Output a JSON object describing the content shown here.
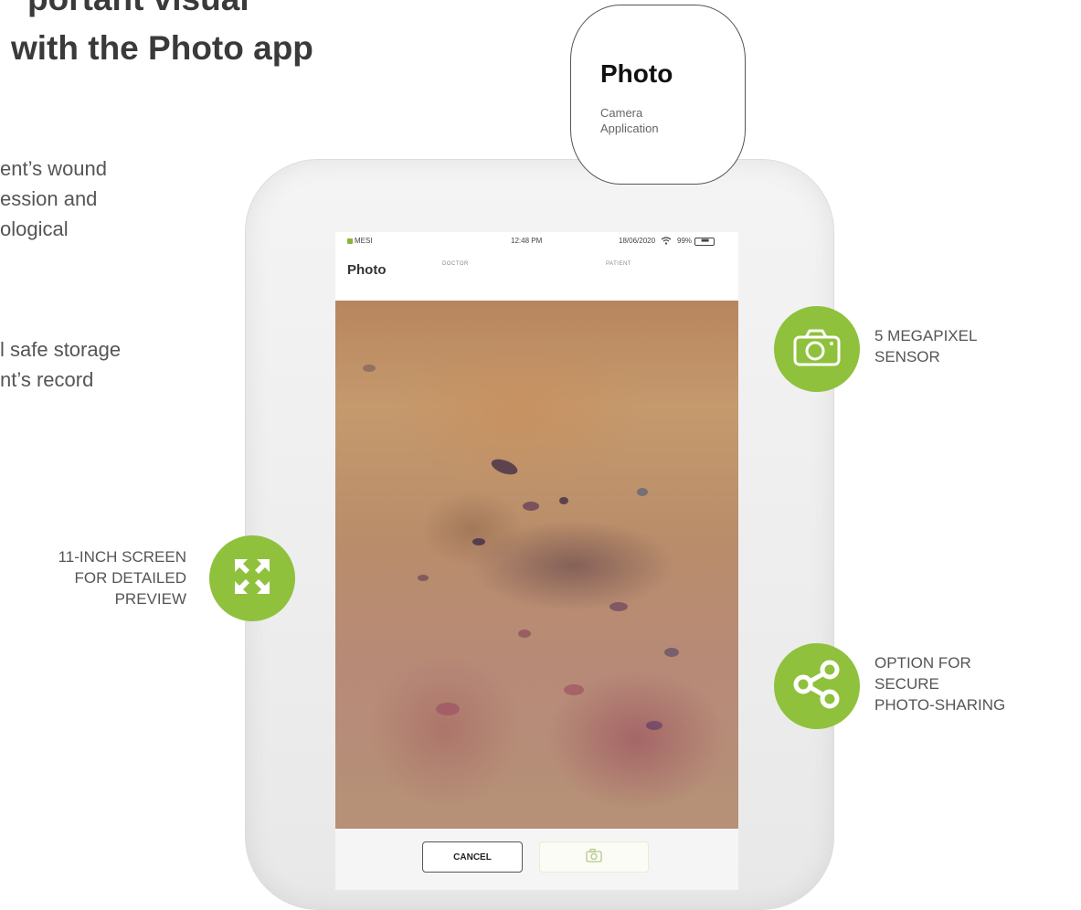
{
  "headline": {
    "line1": "portant visual",
    "line2": "with the Photo app"
  },
  "paragraphs": {
    "first": [
      "ent’s wound",
      "ession and",
      "ological"
    ],
    "second": [
      "l safe storage",
      "nt’s record"
    ]
  },
  "app_card": {
    "title": "Photo",
    "subtitle_line1": "Camera",
    "subtitle_line2": "Application"
  },
  "tablet": {
    "status_bar": {
      "app_name": "MESI",
      "time": "12:48 PM",
      "date": "18/06/2020",
      "battery_pct": "99%"
    },
    "app_title": "Photo",
    "header_doctor": "DOCTOR",
    "header_patient": "PATIENT",
    "cancel_label": "CANCEL"
  },
  "features": {
    "camera": {
      "line1": "5 MEGAPIXEL",
      "line2": "SENSOR",
      "icon": "camera-icon"
    },
    "screen": {
      "line1": "11-INCH SCREEN",
      "line2": "FOR DETAILED",
      "line3": "PREVIEW",
      "icon": "expand-icon"
    },
    "share": {
      "line1": "OPTION FOR",
      "line2": "SECURE",
      "line3": "PHOTO-SHARING",
      "icon": "share-icon"
    }
  },
  "colors": {
    "accent_green": "#8fc13d",
    "heading_text": "#3a3a3a",
    "body_text": "#555555"
  }
}
